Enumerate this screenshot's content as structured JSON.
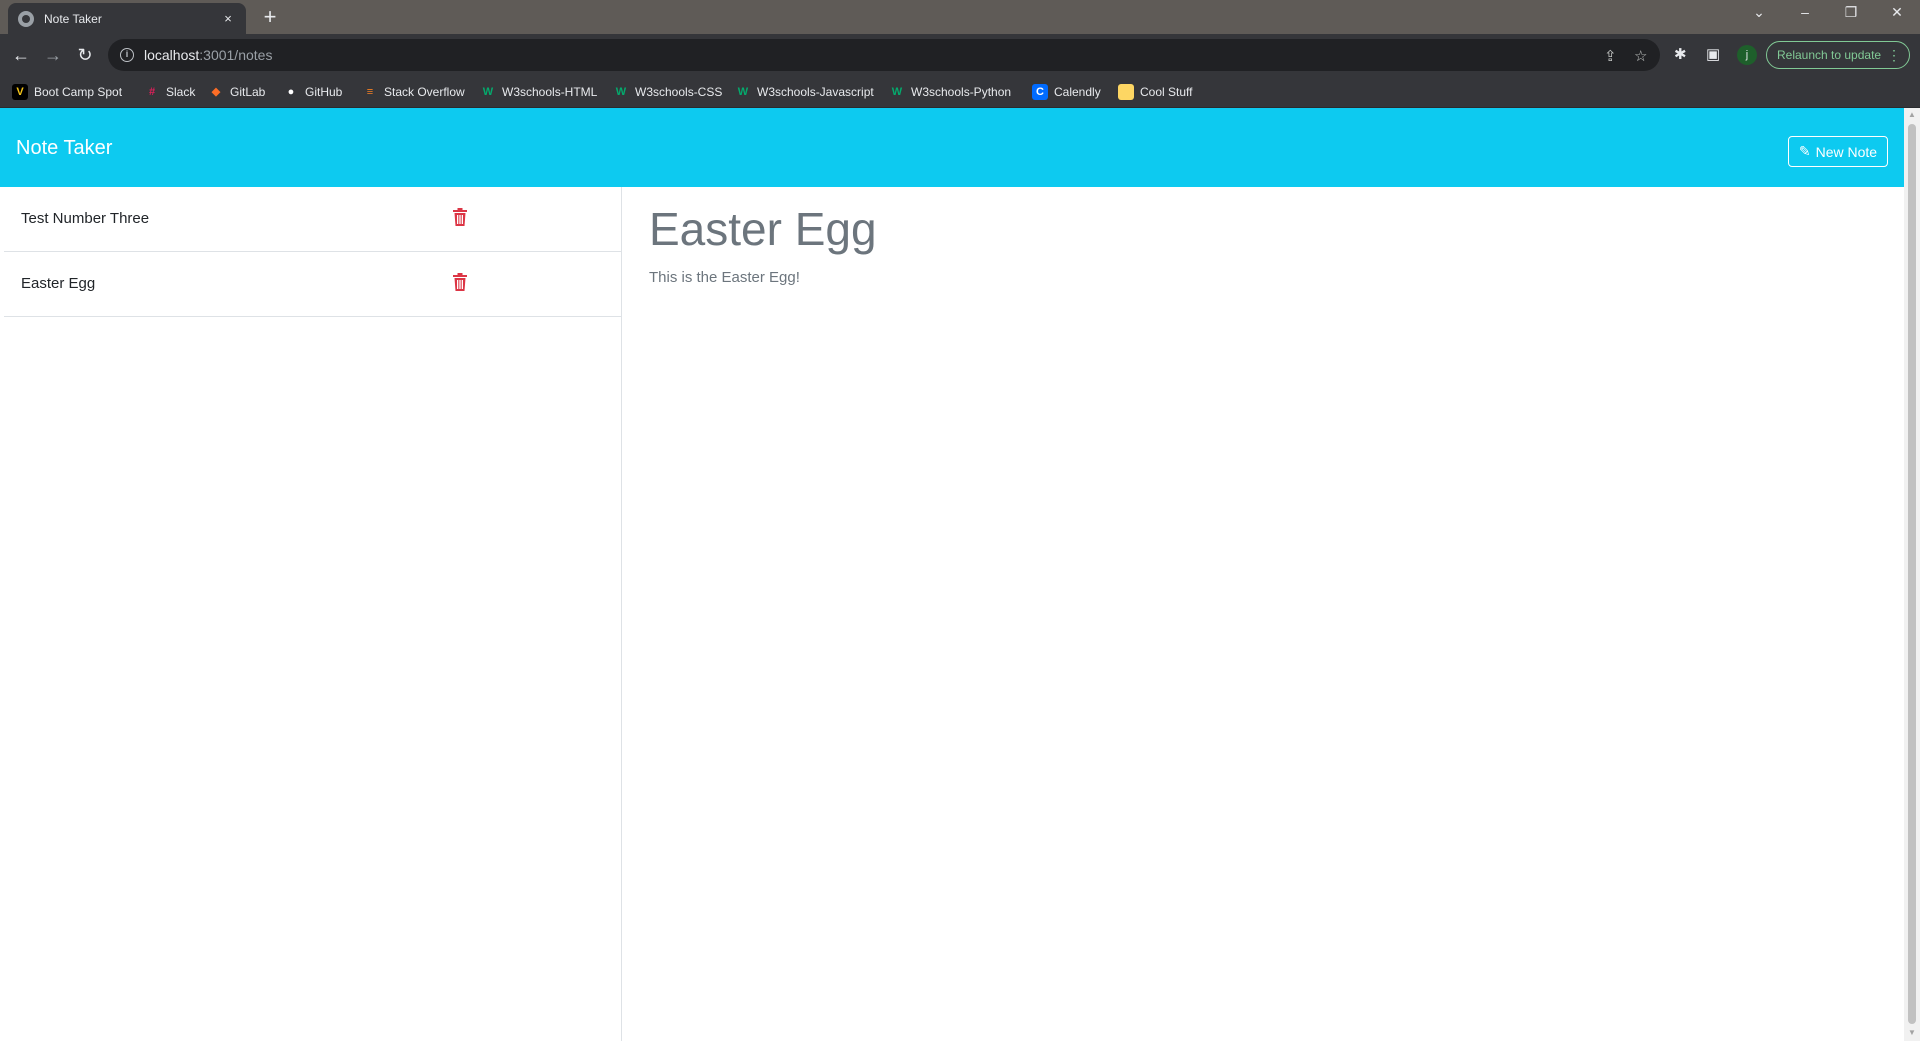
{
  "browser": {
    "tab_title": "Note Taker",
    "tab_close": "×",
    "new_tab": "+",
    "url_host": "localhost",
    "url_path": ":3001/notes",
    "profile_initial": "j",
    "relaunch_label": "Relaunch to update",
    "bookmarks": [
      {
        "label": "Boot Camp Spot",
        "icon": "bootcamp-icon",
        "glyph": "V",
        "bg": "#000000",
        "fg": "#f5c518"
      },
      {
        "label": "Slack",
        "icon": "slack-icon",
        "glyph": "#",
        "bg": "transparent",
        "fg": "#e01e5a"
      },
      {
        "label": "GitLab",
        "icon": "gitlab-icon",
        "glyph": "◆",
        "bg": "transparent",
        "fg": "#fc6d26"
      },
      {
        "label": "GitHub",
        "icon": "github-icon",
        "glyph": "●",
        "bg": "transparent",
        "fg": "#ffffff"
      },
      {
        "label": "Stack Overflow",
        "icon": "stackoverflow-icon",
        "glyph": "≡",
        "bg": "transparent",
        "fg": "#f48024"
      },
      {
        "label": "W3schools-HTML",
        "icon": "w3schools-icon",
        "glyph": "W",
        "bg": "transparent",
        "fg": "#04aa6d"
      },
      {
        "label": "W3schools-CSS",
        "icon": "w3schools-icon",
        "glyph": "W",
        "bg": "transparent",
        "fg": "#04aa6d"
      },
      {
        "label": "W3schools-Javascript",
        "icon": "w3schools-icon",
        "glyph": "W",
        "bg": "transparent",
        "fg": "#04aa6d"
      },
      {
        "label": "W3schools-Python",
        "icon": "w3schools-icon",
        "glyph": "W",
        "bg": "transparent",
        "fg": "#04aa6d"
      },
      {
        "label": "Calendly",
        "icon": "calendly-icon",
        "glyph": "C",
        "bg": "#006bff",
        "fg": "#ffffff"
      },
      {
        "label": "Cool Stuff",
        "icon": "folder-icon",
        "glyph": "",
        "bg": "#fdd663",
        "fg": "#fdd663"
      }
    ]
  },
  "app": {
    "brand": "Note Taker",
    "new_note_label": "New Note",
    "accent_color": "#0dcaf0",
    "delete_color": "#dc3545",
    "notes": [
      {
        "title": "Test Number Three"
      },
      {
        "title": "Easter Egg"
      }
    ],
    "active_note": {
      "title": "Easter Egg",
      "text": "This is the Easter Egg!"
    }
  }
}
